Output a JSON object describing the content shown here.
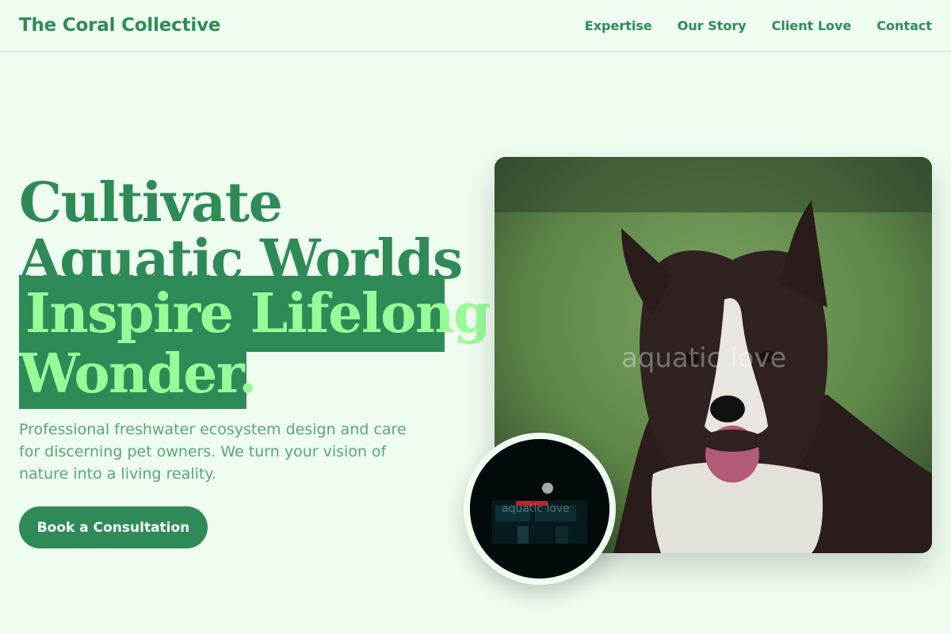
{
  "header": {
    "brand": "The Coral Collective",
    "nav": [
      {
        "label": "Expertise"
      },
      {
        "label": "Our Story"
      },
      {
        "label": "Client Love"
      },
      {
        "label": "Contact"
      }
    ]
  },
  "hero": {
    "title_line1": "Cultivate",
    "title_line2": "Aquatic Worlds.",
    "title_line3": "Inspire Lifelong",
    "title_line4": "Wonder.",
    "subtitle": "Professional freshwater ecosystem design and care for discerning pet owners. We turn your vision of nature into a living reality.",
    "cta_label": "Book a Consultation"
  },
  "media": {
    "main_watermark": "aquatic love",
    "inset_watermark": "aquatic love",
    "main_image": "dog-photo",
    "inset_image": "night-storefront-photo"
  },
  "colors": {
    "primary": "#2e8b57",
    "accent": "#98fb98",
    "background": "#effdf0"
  }
}
